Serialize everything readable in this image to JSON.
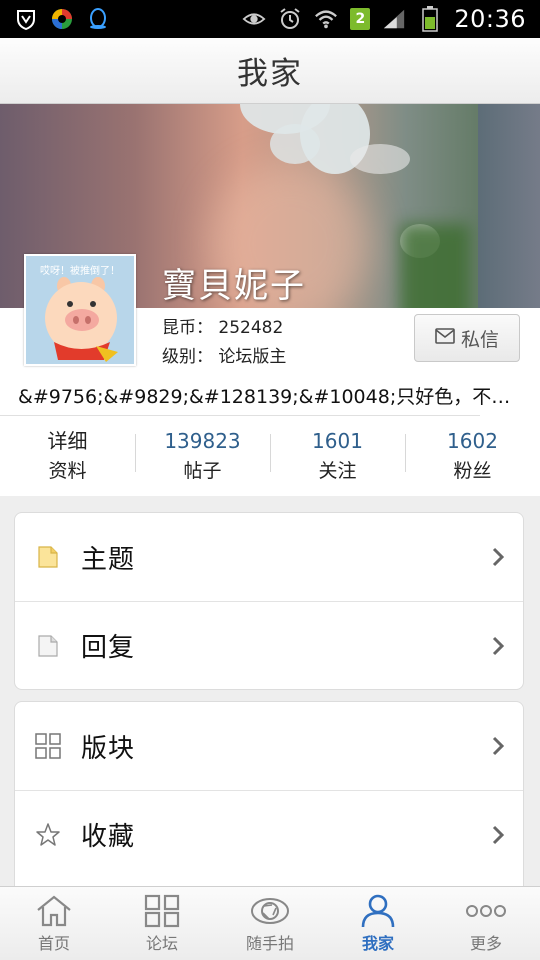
{
  "status_bar": {
    "time": "20:36",
    "sim_slot": "2"
  },
  "header": {
    "title": "我家"
  },
  "profile": {
    "username": "寶貝妮子",
    "avatar_caption": "哎呀！被推倒了！",
    "coins_label": "昆币：",
    "coins_value": "252482",
    "level_label": "级别：",
    "level_value": "论坛版主",
    "message_button": "私信",
    "signature": "&#9756;&#9829;&#128139;&#10048;只好色，不…"
  },
  "stats": [
    {
      "value": "详细",
      "label": "资料"
    },
    {
      "value": "139823",
      "label": "帖子"
    },
    {
      "value": "1601",
      "label": "关注"
    },
    {
      "value": "1602",
      "label": "粉丝"
    }
  ],
  "menu": {
    "group1": [
      {
        "label": "主题",
        "icon": "folder-icon"
      },
      {
        "label": "回复",
        "icon": "document-icon"
      }
    ],
    "group2": [
      {
        "label": "版块",
        "icon": "grid-icon"
      },
      {
        "label": "收藏",
        "icon": "star-icon"
      }
    ]
  },
  "tabbar": {
    "tabs": [
      {
        "label": "首页",
        "icon": "home-icon"
      },
      {
        "label": "论坛",
        "icon": "grid-icon"
      },
      {
        "label": "随手拍",
        "icon": "camera-aperture-icon"
      },
      {
        "label": "我家",
        "icon": "person-icon",
        "active": true
      },
      {
        "label": "更多",
        "icon": "more-dots-icon"
      }
    ]
  },
  "colors": {
    "accent": "#2f6fc0",
    "stat_number": "#2f5f8c"
  }
}
